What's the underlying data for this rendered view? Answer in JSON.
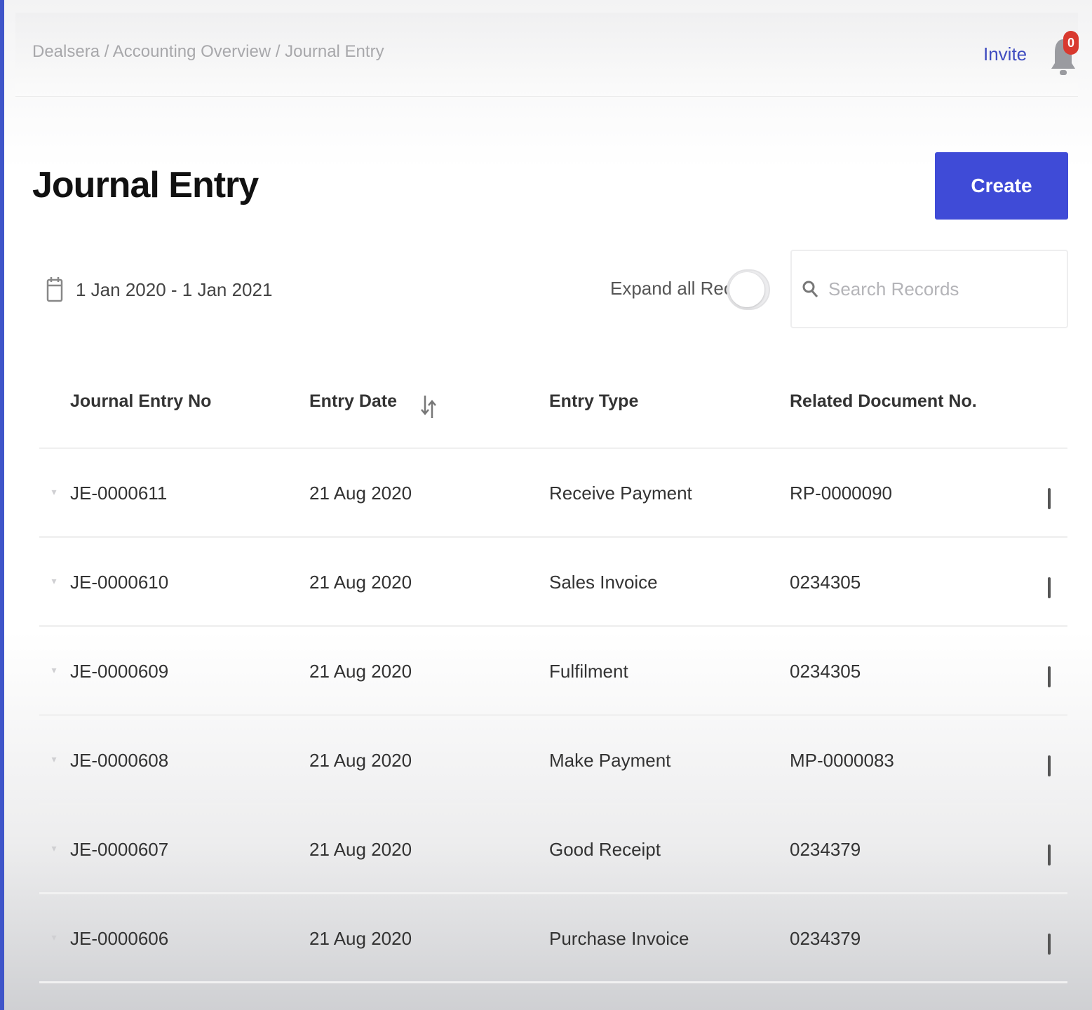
{
  "header": {
    "breadcrumb": "Dealsera / Accounting Overview / Journal Entry",
    "invite_label": "Invite",
    "notification_count": "0"
  },
  "page": {
    "title": "Journal Entry",
    "create_label": "Create"
  },
  "filters": {
    "date_range": "1 Jan 2020 - 1 Jan 2021",
    "expand_label": "Expand all Records",
    "expand_on": false,
    "search_value": "",
    "search_placeholder": "Search Records"
  },
  "table": {
    "columns": [
      "Journal Entry No",
      "Entry Date",
      "Entry Type",
      "Related Document No."
    ],
    "rows": [
      {
        "no": "JE-0000611",
        "date": "21 Aug 2020",
        "type": "Receive Payment",
        "doc": "RP-0000090"
      },
      {
        "no": "JE-0000610",
        "date": "21 Aug 2020",
        "type": "Sales Invoice",
        "doc": "0234305"
      },
      {
        "no": "JE-0000609",
        "date": "21 Aug 2020",
        "type": "Fulfilment",
        "doc": "0234305"
      },
      {
        "no": "JE-0000608",
        "date": "21 Aug 2020",
        "type": "Make Payment",
        "doc": "MP-0000083"
      },
      {
        "no": "JE-0000607",
        "date": "21 Aug 2020",
        "type": "Good Receipt",
        "doc": "0234379"
      },
      {
        "no": "JE-0000606",
        "date": "21 Aug 2020",
        "type": "Purchase Invoice",
        "doc": "0234379"
      }
    ]
  },
  "colors": {
    "accent": "#3f4bd7",
    "badge": "#d8392f",
    "link": "#3f4cc0"
  },
  "icons": {
    "bell": "bell-icon",
    "calendar": "calendar-icon",
    "search": "search-icon",
    "sort": "sort-icon",
    "row_toggle": "chevron-down-icon",
    "row_menu": "kebab-menu-icon"
  }
}
